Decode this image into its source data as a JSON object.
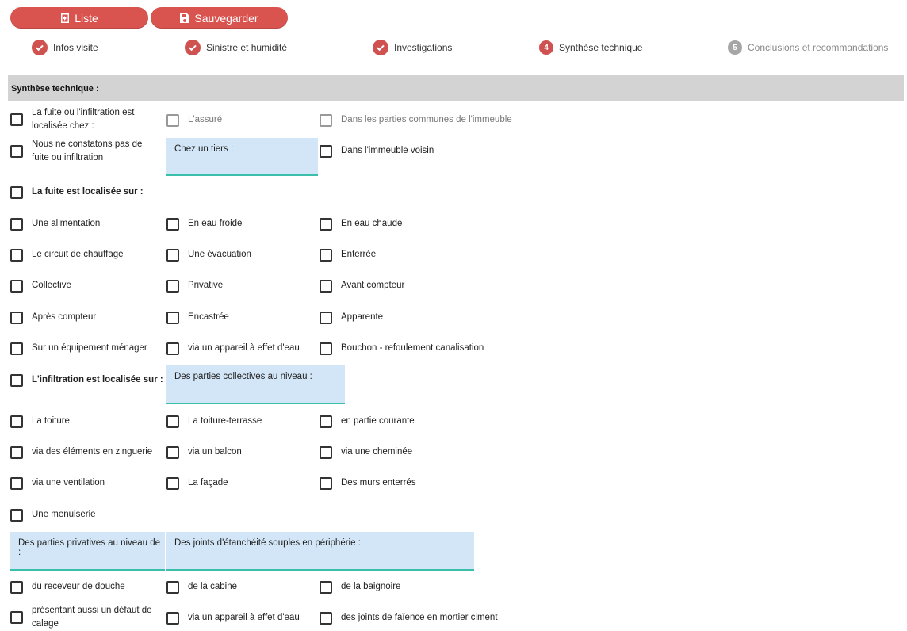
{
  "toolbar": {
    "liste_label": "Liste",
    "save_label": "Sauvegarder",
    "accent": "#d9534f"
  },
  "stepper": {
    "steps": [
      {
        "label": "Infos visite",
        "state": "done"
      },
      {
        "label": "Sinistre et humidité",
        "state": "done"
      },
      {
        "label": "Investigations",
        "state": "done"
      },
      {
        "label": "Synthèse technique",
        "state": "active",
        "number": "4"
      },
      {
        "label": "Conclusions et recommandations",
        "state": "todo",
        "number": "5"
      }
    ]
  },
  "section": {
    "title": "Synthèse technique :"
  },
  "rows": {
    "fuite_localisee_chez": "La fuite ou l'infiltration est localisée chez :",
    "assure": "L'assuré",
    "parties_communes": "Dans les parties communes de l'immeuble",
    "pas_de_fuite": "Nous ne constatons pas de fuite ou infiltration",
    "chez_tiers_label": "Chez un tiers :",
    "immeuble_voisin": "Dans l'immeuble voisin",
    "fuite_localisee_sur": "La fuite est localisée sur :",
    "alimentation": "Une alimentation",
    "eau_froide": "En eau froide",
    "eau_chaude": "En eau chaude",
    "circuit_chauffage": "Le circuit de chauffage",
    "evacuation": "Une évacuation",
    "enterree": "Enterrée",
    "collective": "Collective",
    "privative": "Privative",
    "avant_compteur": "Avant compteur",
    "apres_compteur": "Après compteur",
    "encastree": "Encastrée",
    "apparente": "Apparente",
    "equipement_menager": "Sur un équipement ménager",
    "appareil_effet_eau": "via un appareil à effet d'eau",
    "bouchon": "Bouchon - refoulement canalisation",
    "infiltration_localisee_sur": "L'infiltration est localisée sur :",
    "parties_collectives_label": "Des parties collectives au niveau :",
    "toiture": "La toiture",
    "toiture_terrasse": "La toiture-terrasse",
    "partie_courante": "en partie courante",
    "zinguerie": "via des éléments en zinguerie",
    "balcon": "via un balcon",
    "cheminee": "via une cheminée",
    "ventilation": "via une ventilation",
    "facade": "La façade",
    "murs_enterres": "Des murs enterrés",
    "menuiserie": "Une menuiserie",
    "parties_privatives_label": "Des parties privatives au niveau de :",
    "joints_etancheite_label": "Des joints d'étanchéité souples en périphérie :",
    "receveur_douche": "du receveur de douche",
    "cabine": "de la cabine",
    "baignoire": "de la baignoire",
    "defaut_calage": "présentant aussi un défaut de calage",
    "appareil_effet_eau_2": "via un appareil à effet d'eau",
    "joints_faience": "des joints de faïence en mortier ciment"
  }
}
